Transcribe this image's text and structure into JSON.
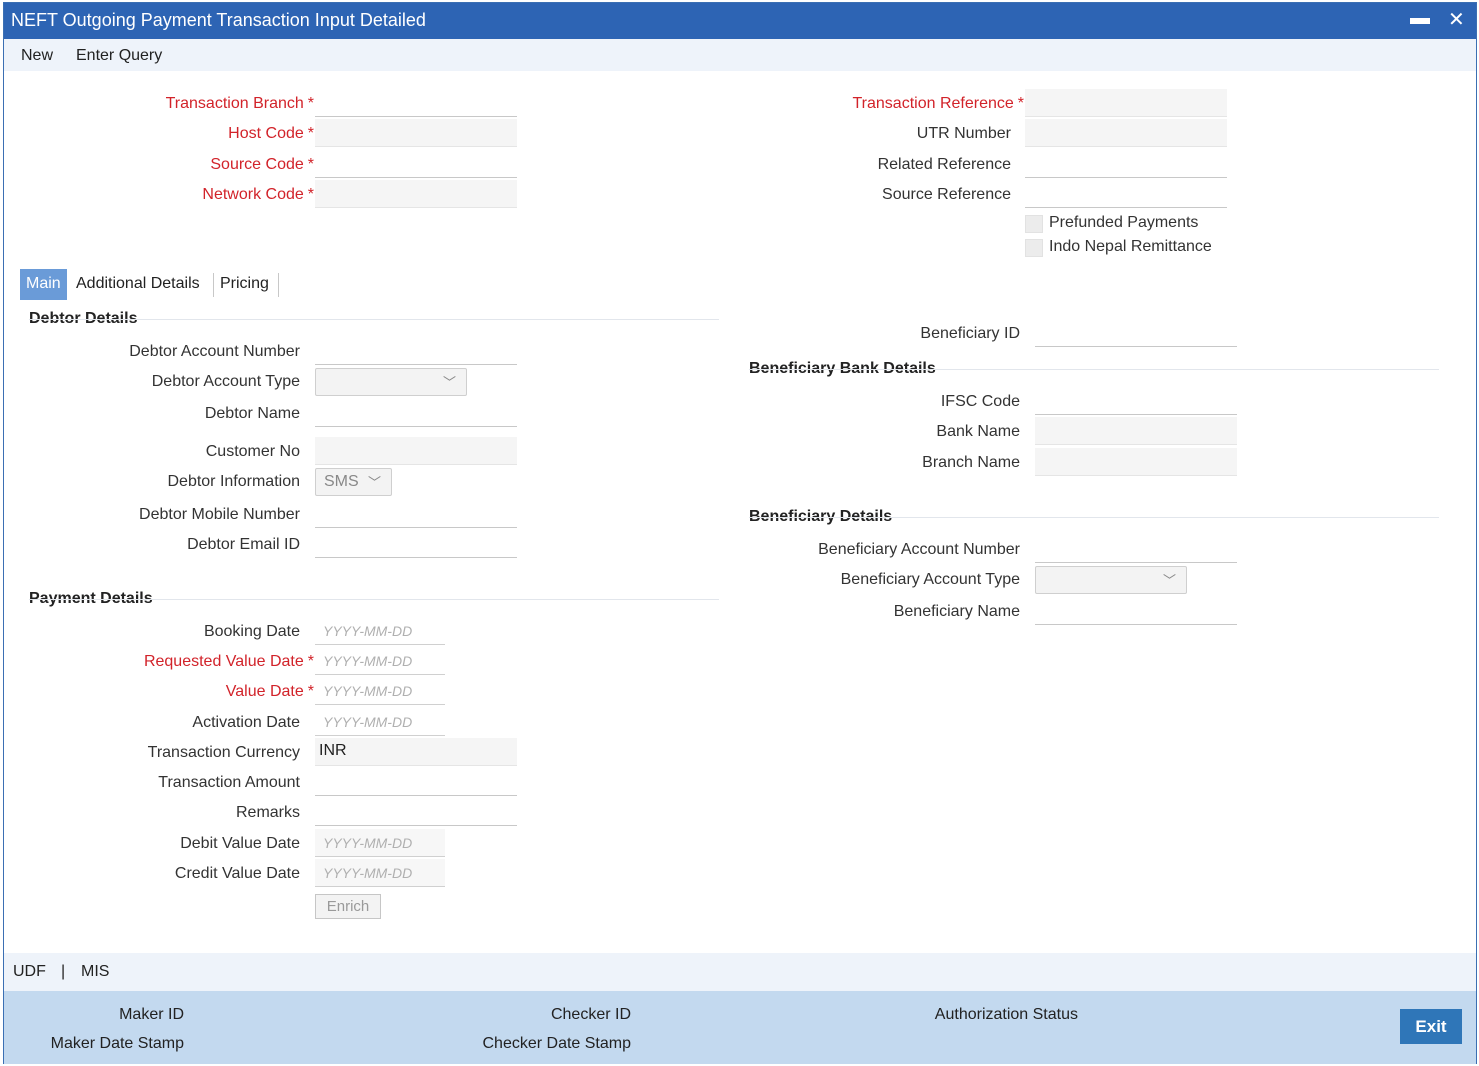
{
  "window": {
    "title": "NEFT Outgoing Payment Transaction Input Detailed",
    "minimize": "▬",
    "close": "✕"
  },
  "menu": {
    "new": "New",
    "enter_query": "Enter Query"
  },
  "header_left": {
    "transaction_branch": "Transaction Branch",
    "host_code": "Host Code",
    "source_code": "Source Code",
    "network_code": "Network Code"
  },
  "header_right": {
    "transaction_reference": "Transaction Reference",
    "utr_number": "UTR Number",
    "related_reference": "Related Reference",
    "source_reference": "Source Reference",
    "prefunded_payments": "Prefunded Payments",
    "indo_nepal_remittance": "Indo Nepal Remittance"
  },
  "required_mark": "*",
  "tabs": {
    "main": "Main",
    "additional": "Additional Details",
    "pricing": "Pricing"
  },
  "debtor": {
    "section": "Debtor Details",
    "account_number": "Debtor Account Number",
    "account_type": "Debtor Account Type",
    "name": "Debtor Name",
    "customer_no": "Customer No",
    "information": "Debtor Information",
    "information_value": "SMS",
    "mobile": "Debtor Mobile Number",
    "email": "Debtor Email ID"
  },
  "payment": {
    "section": "Payment Details",
    "booking_date": "Booking Date",
    "requested_value_date": "Requested Value Date",
    "value_date": "Value Date",
    "activation_date": "Activation Date",
    "currency": "Transaction Currency",
    "currency_value": "INR",
    "amount": "Transaction Amount",
    "remarks": "Remarks",
    "debit_value_date": "Debit Value Date",
    "credit_value_date": "Credit Value Date",
    "date_placeholder": "YYYY-MM-DD",
    "enrich": "Enrich"
  },
  "beneficiary": {
    "id": "Beneficiary ID",
    "bank_section": "Beneficiary Bank Details",
    "ifsc": "IFSC Code",
    "bank_name": "Bank Name",
    "branch_name": "Branch Name",
    "details_section": "Beneficiary Details",
    "account_number": "Beneficiary Account Number",
    "account_type": "Beneficiary Account Type",
    "name": "Beneficiary Name"
  },
  "footer": {
    "udf": "UDF",
    "sep": "|",
    "mis": "MIS",
    "maker_id": "Maker ID",
    "maker_date_stamp": "Maker Date Stamp",
    "checker_id": "Checker ID",
    "checker_date_stamp": "Checker Date Stamp",
    "authorization_status": "Authorization Status",
    "exit": "Exit"
  }
}
